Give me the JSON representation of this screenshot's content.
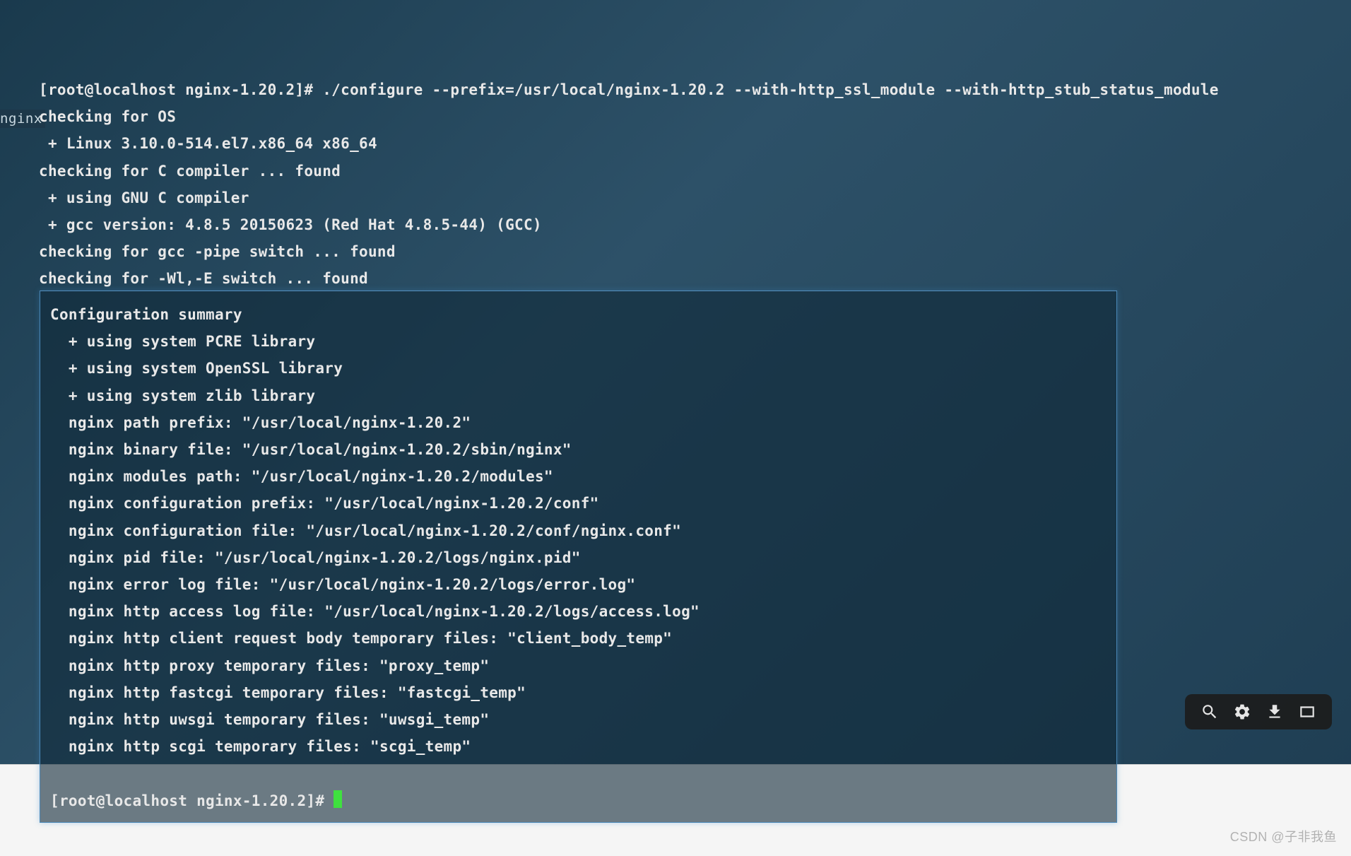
{
  "left_tab": "nginx",
  "upper_lines": [
    "[root@localhost nginx-1.20.2]# ./configure --prefix=/usr/local/nginx-1.20.2 --with-http_ssl_module --with-http_stub_status_module",
    "checking for OS",
    " + Linux 3.10.0-514.el7.x86_64 x86_64",
    "checking for C compiler ... found",
    " + using GNU C compiler",
    " + gcc version: 4.8.5 20150623 (Red Hat 4.8.5-44) (GCC)",
    "checking for gcc -pipe switch ... found",
    "checking for -Wl,-E switch ... found"
  ],
  "lower_lines": [
    "Configuration summary",
    "  + using system PCRE library",
    "  + using system OpenSSL library",
    "  + using system zlib library",
    "",
    "  nginx path prefix: \"/usr/local/nginx-1.20.2\"",
    "  nginx binary file: \"/usr/local/nginx-1.20.2/sbin/nginx\"",
    "  nginx modules path: \"/usr/local/nginx-1.20.2/modules\"",
    "  nginx configuration prefix: \"/usr/local/nginx-1.20.2/conf\"",
    "  nginx configuration file: \"/usr/local/nginx-1.20.2/conf/nginx.conf\"",
    "  nginx pid file: \"/usr/local/nginx-1.20.2/logs/nginx.pid\"",
    "  nginx error log file: \"/usr/local/nginx-1.20.2/logs/error.log\"",
    "  nginx http access log file: \"/usr/local/nginx-1.20.2/logs/access.log\"",
    "  nginx http client request body temporary files: \"client_body_temp\"",
    "  nginx http proxy temporary files: \"proxy_temp\"",
    "  nginx http fastcgi temporary files: \"fastcgi_temp\"",
    "  nginx http uwsgi temporary files: \"uwsgi_temp\"",
    "  nginx http scgi temporary files: \"scgi_temp\""
  ],
  "prompt": "[root@localhost nginx-1.20.2]# ",
  "watermark": "CSDN @子非我鱼",
  "icons": {
    "search": "search-icon",
    "gear": "gear-icon",
    "download": "download-icon",
    "fullscreen": "fullscreen-icon"
  }
}
